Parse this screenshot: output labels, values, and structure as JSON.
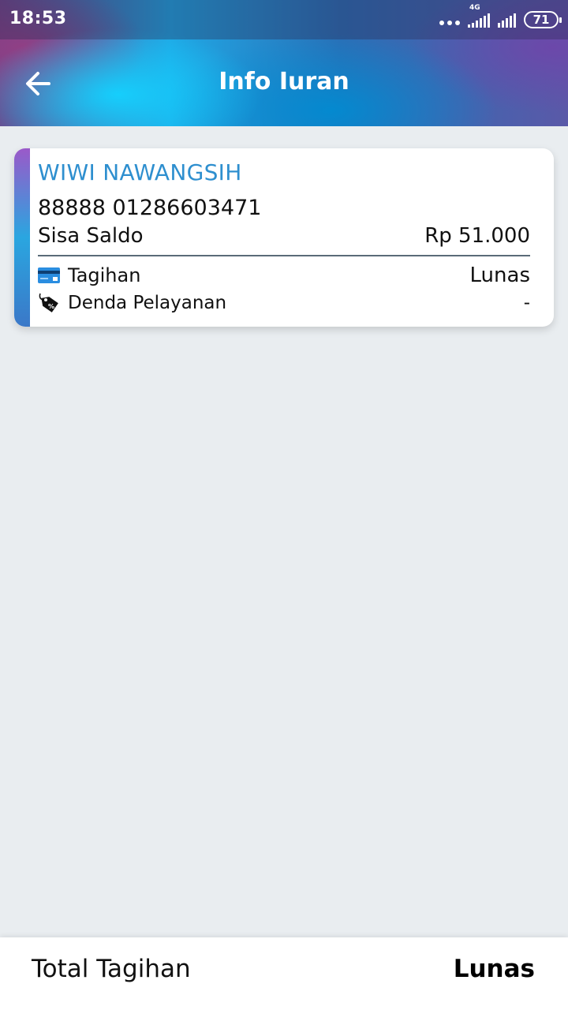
{
  "status": {
    "time": "18:53",
    "network": "4G",
    "battery": "71"
  },
  "header": {
    "title": "Info Iuran",
    "back_icon": "arrow-left-icon"
  },
  "card": {
    "name": "WIWI NAWANGSIH",
    "account_number": "88888 01286603471",
    "balance_label": "Sisa Saldo",
    "balance_value": "Rp 51.000",
    "bill_label": "Tagihan",
    "bill_value": "Lunas",
    "bill_icon": "credit-card-icon",
    "fine_label": "Denda Pelayanan",
    "fine_value": "-",
    "fine_icon": "discount-tag-icon",
    "name_color": "#2e8fcf"
  },
  "footer": {
    "total_label": "Total Tagihan",
    "total_value": "Lunas"
  }
}
